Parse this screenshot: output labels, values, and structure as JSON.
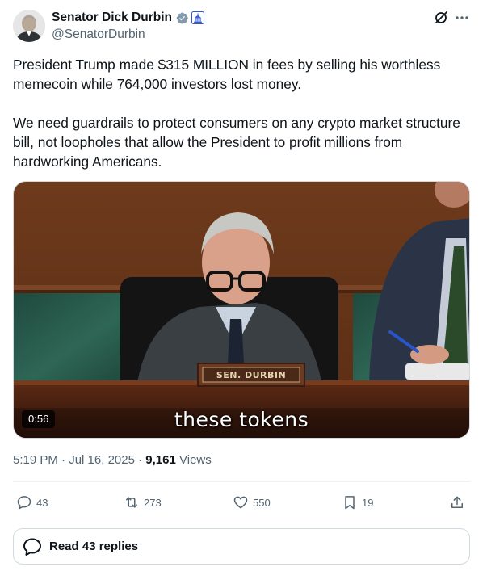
{
  "author": {
    "display_name": "Senator Dick Durbin",
    "handle": "@SenatorDurbin",
    "verified_color": "#829aab",
    "gov_badge_color": "#3057d6"
  },
  "header_icons": [
    "grok-icon",
    "more-icon"
  ],
  "tweet": {
    "paragraph_1": "President Trump made $315 MILLION in fees by selling his worthless memecoin while 764,000 investors lost money.",
    "paragraph_2": "We need guardrails to protect consumers on any crypto market structure bill, not loopholes that allow the President to profit millions from hardworking Americans."
  },
  "media": {
    "duration": "0:56",
    "caption": "these tokens",
    "nameplate": "SEN. DURBIN"
  },
  "meta": {
    "time": "5:19 PM",
    "separator": "·",
    "date": "Jul 16, 2025",
    "views_count": "9,161",
    "views_label": "Views"
  },
  "actions": {
    "replies": "43",
    "reposts": "273",
    "likes": "550",
    "bookmarks": "19"
  },
  "read_replies_label": "Read 43 replies",
  "colors": {
    "text_primary": "#0f1419",
    "text_secondary": "#536471",
    "border": "#cfd9de"
  }
}
